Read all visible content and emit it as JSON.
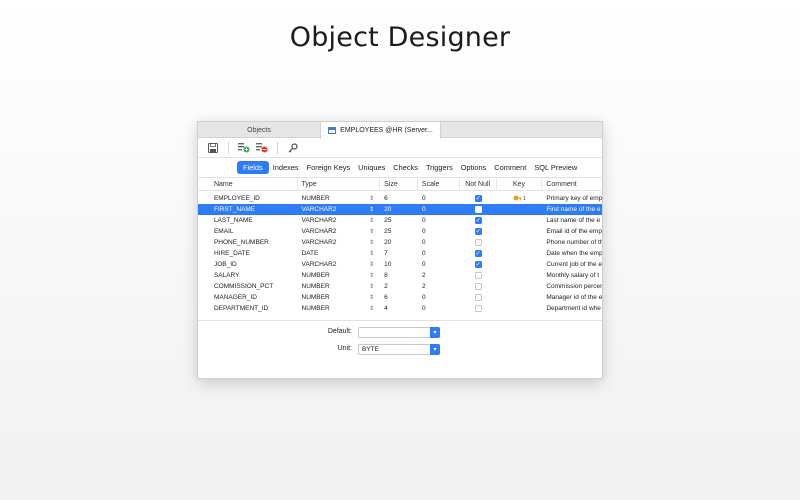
{
  "headline": "Object Designer",
  "tabs": {
    "objects": "Objects",
    "active": "EMPLOYEES @HR (Server..."
  },
  "toolbar": {
    "save_icon": "save-icon",
    "add_field_icon": "add-field-icon",
    "remove_field_icon": "remove-field-icon",
    "key_icon": "key-icon"
  },
  "subtabs": [
    "Fields",
    "Indexes",
    "Foreign Keys",
    "Uniques",
    "Checks",
    "Triggers",
    "Options",
    "Comment",
    "SQL Preview"
  ],
  "columns": {
    "name": "Name",
    "type": "Type",
    "size": "Size",
    "scale": "Scale",
    "not_null": "Not Null",
    "key": "Key",
    "comment": "Comment"
  },
  "rows": [
    {
      "name": "EMPLOYEE_ID",
      "type": "NUMBER",
      "size": "6",
      "scale": "0",
      "not_null": true,
      "key": "1",
      "comment": "Primary key of emp"
    },
    {
      "name": "FIRST_NAME",
      "type": "VARCHAR2",
      "size": "20",
      "scale": "0",
      "not_null": false,
      "key": "",
      "comment": "First name of the e"
    },
    {
      "name": "LAST_NAME",
      "type": "VARCHAR2",
      "size": "25",
      "scale": "0",
      "not_null": true,
      "key": "",
      "comment": "Last name of the e"
    },
    {
      "name": "EMAIL",
      "type": "VARCHAR2",
      "size": "25",
      "scale": "0",
      "not_null": true,
      "key": "",
      "comment": "Email id of the emp"
    },
    {
      "name": "PHONE_NUMBER",
      "type": "VARCHAR2",
      "size": "20",
      "scale": "0",
      "not_null": false,
      "key": "",
      "comment": "Phone number of th"
    },
    {
      "name": "HIRE_DATE",
      "type": "DATE",
      "size": "7",
      "scale": "0",
      "not_null": true,
      "key": "",
      "comment": "Date when the emp"
    },
    {
      "name": "JOB_ID",
      "type": "VARCHAR2",
      "size": "10",
      "scale": "0",
      "not_null": true,
      "key": "",
      "comment": "Current job of the e"
    },
    {
      "name": "SALARY",
      "type": "NUMBER",
      "size": "8",
      "scale": "2",
      "not_null": false,
      "key": "",
      "comment": "Monthly salary of t"
    },
    {
      "name": "COMMISSION_PCT",
      "type": "NUMBER",
      "size": "2",
      "scale": "2",
      "not_null": false,
      "key": "",
      "comment": "Commission percen"
    },
    {
      "name": "MANAGER_ID",
      "type": "NUMBER",
      "size": "6",
      "scale": "0",
      "not_null": false,
      "key": "",
      "comment": "Manager id of the e"
    },
    {
      "name": "DEPARTMENT_ID",
      "type": "NUMBER",
      "size": "4",
      "scale": "0",
      "not_null": false,
      "key": "",
      "comment": "Department id whe"
    }
  ],
  "selected_row": 1,
  "properties": {
    "default_label": "Default:",
    "default_value": "",
    "unit_label": "Unit:",
    "unit_value": "BYTE"
  },
  "colors": {
    "accent": "#2e7cf6",
    "key_gold": "#e0a020"
  }
}
